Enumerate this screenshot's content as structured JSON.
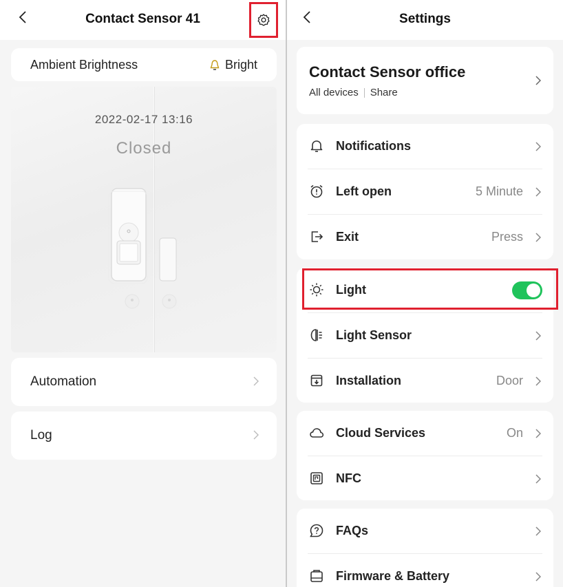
{
  "left": {
    "title": "Contact Sensor 41",
    "ambient": {
      "label": "Ambient Brightness",
      "value": "Bright"
    },
    "status": {
      "time": "2022-02-17 13:16",
      "state": "Closed"
    },
    "nav": [
      {
        "label": "Automation"
      },
      {
        "label": "Log"
      }
    ]
  },
  "right": {
    "title": "Settings",
    "device": {
      "name": "Contact Sensor office",
      "link_all": "All devices",
      "link_share": "Share"
    },
    "section1": [
      {
        "label": "Notifications",
        "value": "",
        "icon": "bell-icon"
      },
      {
        "label": "Left open",
        "value": "5 Minute",
        "icon": "alarm-clock-icon"
      },
      {
        "label": "Exit",
        "value": "Press",
        "icon": "exit-icon"
      }
    ],
    "section2": [
      {
        "label": "Light",
        "icon": "sun-icon",
        "toggle_on": true
      },
      {
        "label": "Light Sensor",
        "value": "",
        "icon": "light-sensor-icon"
      },
      {
        "label": "Installation",
        "value": "Door",
        "icon": "installation-icon"
      }
    ],
    "section3": [
      {
        "label": "Cloud Services",
        "value": "On",
        "icon": "cloud-icon"
      },
      {
        "label": "NFC",
        "value": "",
        "icon": "nfc-icon"
      }
    ],
    "section4": [
      {
        "label": "FAQs",
        "value": "",
        "icon": "faq-icon"
      },
      {
        "label": "Firmware & Battery",
        "value": "",
        "icon": "battery-icon"
      }
    ]
  },
  "colors": {
    "highlight": "#e0202f",
    "toggle": "#1fc35b"
  }
}
